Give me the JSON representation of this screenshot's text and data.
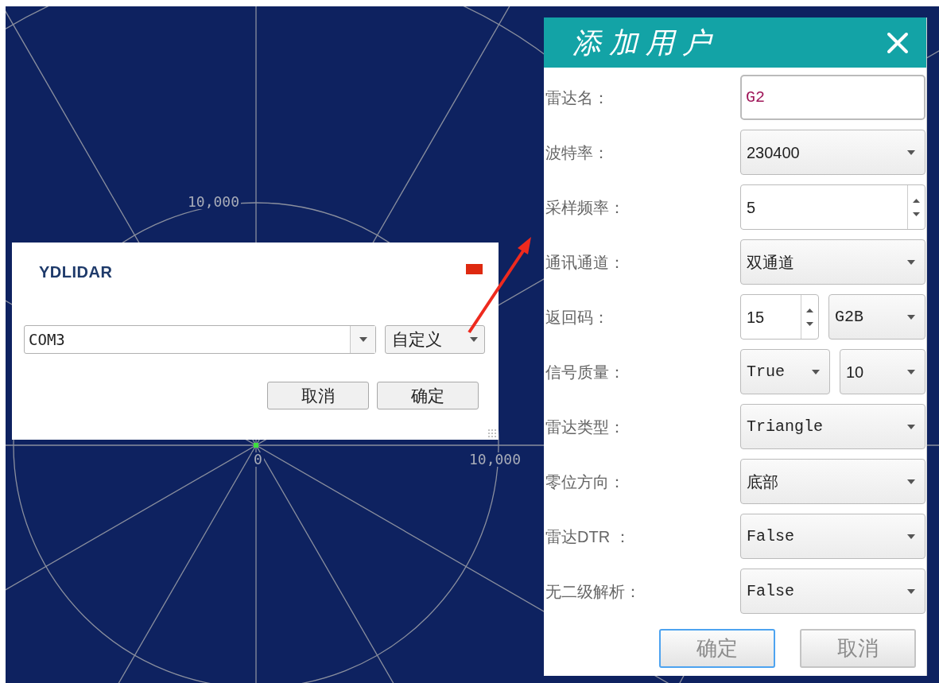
{
  "plot": {
    "labels": [
      "10,000",
      "0",
      "10,000"
    ]
  },
  "port_dialog": {
    "logo": "YDLIDAR",
    "port": "COM3",
    "mode": "自定义",
    "buttons": [
      "取消",
      "确定"
    ]
  },
  "add_dialog": {
    "title": "添加用户",
    "rows": [
      {
        "label": "雷达名：",
        "controls": [
          {
            "kind": "input",
            "value": "G2"
          }
        ]
      },
      {
        "label": "波特率：",
        "controls": [
          {
            "kind": "combo",
            "value": "230400"
          }
        ]
      },
      {
        "label": "采样频率：",
        "controls": [
          {
            "kind": "spin",
            "value": "5"
          }
        ]
      },
      {
        "label": "通讯通道：",
        "controls": [
          {
            "kind": "combo",
            "value": "双通道"
          }
        ]
      },
      {
        "label": "返回码：",
        "controls": [
          {
            "kind": "spin",
            "value": "15"
          },
          {
            "kind": "combo",
            "value": "G2B"
          }
        ]
      },
      {
        "label": "信号质量：",
        "controls": [
          {
            "kind": "combo",
            "value": "True"
          },
          {
            "kind": "combo",
            "value": "10"
          }
        ]
      },
      {
        "label": "雷达类型：",
        "controls": [
          {
            "kind": "combo",
            "value": "Triangle"
          }
        ]
      },
      {
        "label": "零位方向：",
        "controls": [
          {
            "kind": "combo",
            "value": "底部"
          }
        ]
      },
      {
        "label": "雷达DTR ：",
        "controls": [
          {
            "kind": "combo",
            "value": "False"
          }
        ]
      },
      {
        "label": "无二级解析：",
        "controls": [
          {
            "kind": "combo",
            "value": "False"
          }
        ]
      }
    ],
    "buttons": [
      {
        "label": "确定",
        "focused": true
      },
      {
        "label": "取消",
        "focused": false
      }
    ]
  }
}
